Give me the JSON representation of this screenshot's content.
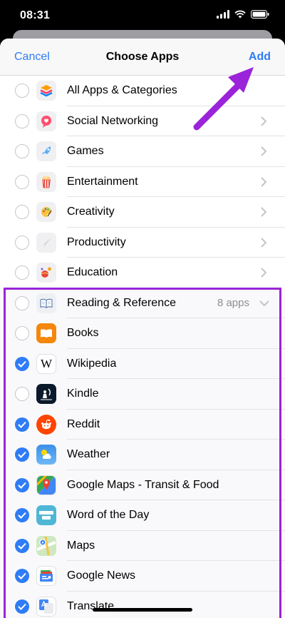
{
  "status": {
    "time": "08:31"
  },
  "nav": {
    "cancel": "Cancel",
    "title": "Choose Apps",
    "add": "Add"
  },
  "categories": [
    {
      "label": "All Apps & Categories",
      "icon": "stack-icon",
      "chevron": false
    },
    {
      "label": "Social Networking",
      "icon": "chat-bubble-icon",
      "chevron": true
    },
    {
      "label": "Games",
      "icon": "rocket-icon",
      "chevron": true
    },
    {
      "label": "Entertainment",
      "icon": "popcorn-icon",
      "chevron": true
    },
    {
      "label": "Creativity",
      "icon": "palette-icon",
      "chevron": true
    },
    {
      "label": "Productivity",
      "icon": "paper-plane-icon",
      "chevron": true
    },
    {
      "label": "Education",
      "icon": "planet-icon",
      "chevron": true
    }
  ],
  "group": {
    "label": "Reading & Reference",
    "count": "8 apps",
    "icon": "open-book-icon",
    "apps": [
      {
        "label": "Books",
        "checked": false,
        "icon": "books-app-icon"
      },
      {
        "label": "Wikipedia",
        "checked": true,
        "icon": "wikipedia-app-icon"
      },
      {
        "label": "Kindle",
        "checked": false,
        "icon": "kindle-app-icon"
      },
      {
        "label": "Reddit",
        "checked": true,
        "icon": "reddit-app-icon"
      },
      {
        "label": "Weather",
        "checked": true,
        "icon": "weather-app-icon"
      },
      {
        "label": "Google Maps - Transit & Food",
        "checked": true,
        "icon": "google-maps-app-icon"
      },
      {
        "label": "Word of the Day",
        "checked": true,
        "icon": "word-of-the-day-app-icon"
      },
      {
        "label": "Maps",
        "checked": true,
        "icon": "maps-app-icon"
      },
      {
        "label": "Google News",
        "checked": true,
        "icon": "google-news-app-icon"
      },
      {
        "label": "Translate",
        "checked": true,
        "icon": "translate-app-icon"
      }
    ]
  },
  "colors": {
    "accent": "#2f7cf6",
    "highlight": "#9b23d9"
  }
}
